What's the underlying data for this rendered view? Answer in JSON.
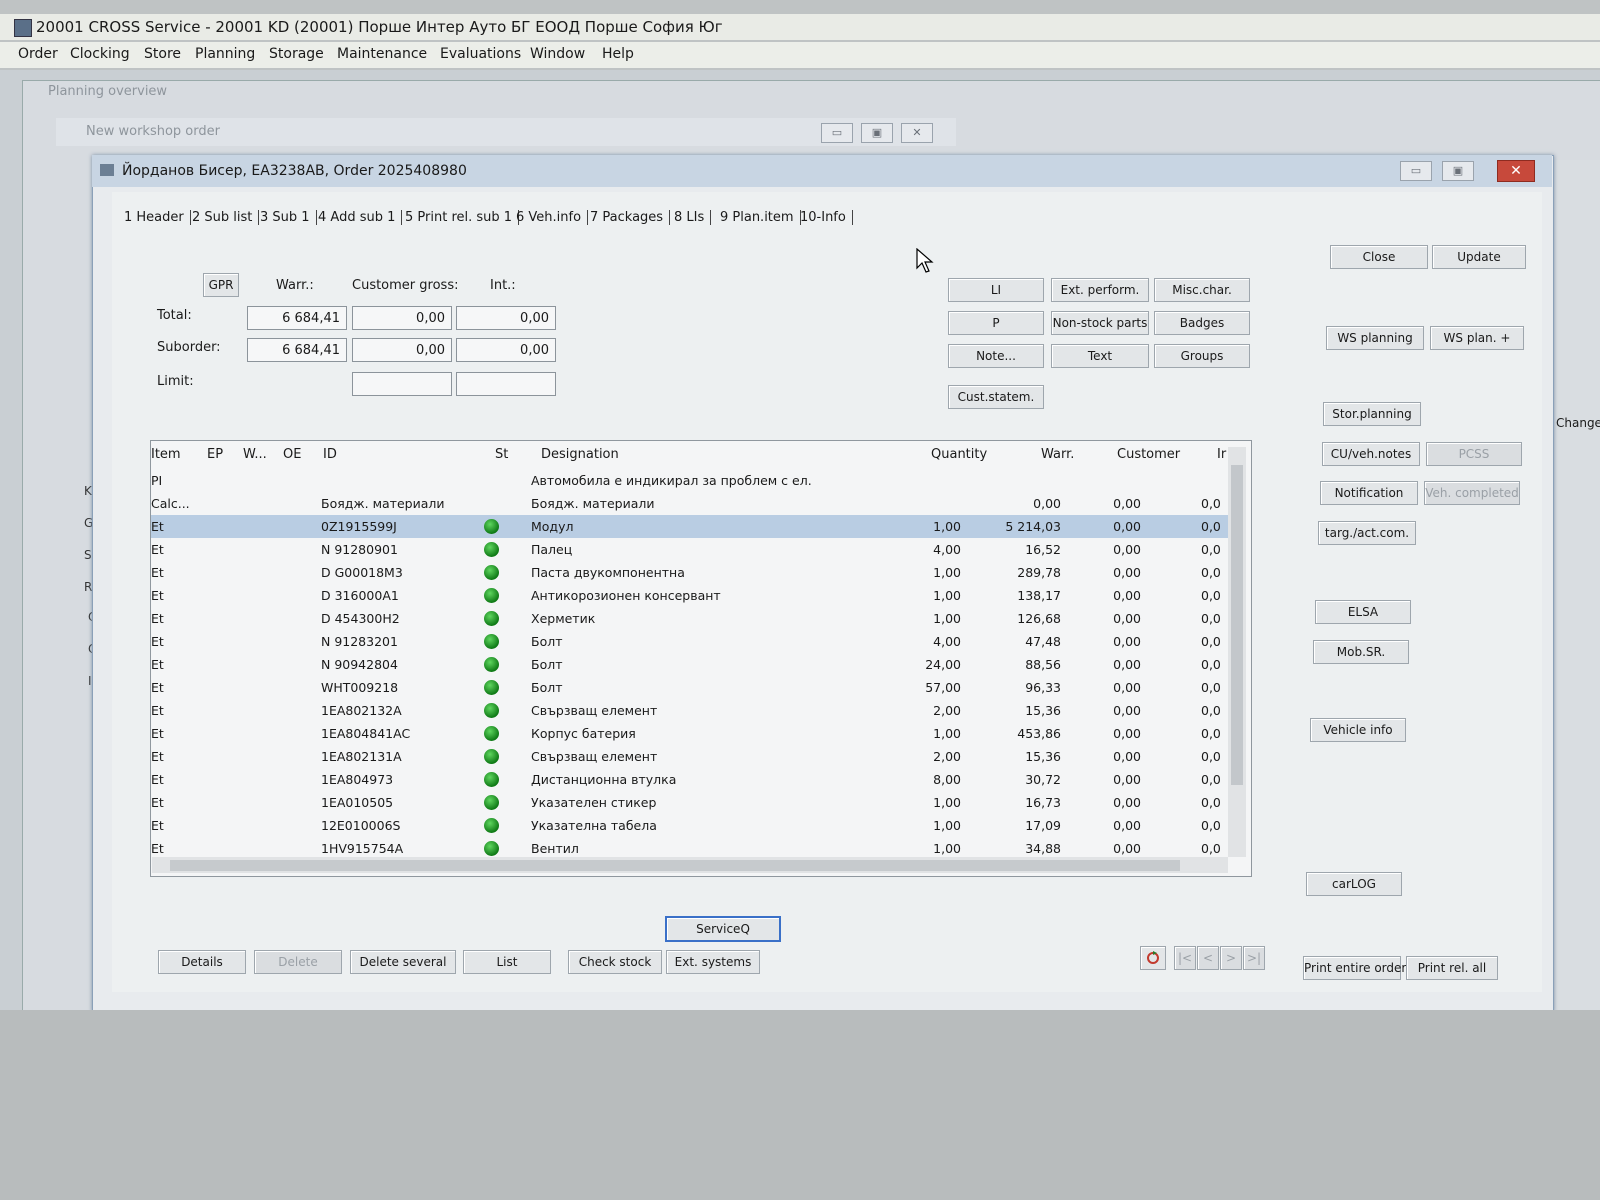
{
  "app": {
    "title": "20001  CROSS Service - 20001 KD (20001) Порше Интер Ауто БГ ЕООД Порше София Юг",
    "menu": [
      "Order",
      "Clocking",
      "Store",
      "Planning",
      "Storage",
      "Maintenance",
      "Evaluations",
      "Window",
      "Help"
    ]
  },
  "windows": {
    "planning_title": "Planning overview",
    "nwo_title": "New workshop order",
    "dialog_title": "Йорданов Бисер, EA3238AB, Order 2025408980",
    "right_edge_label": "Change U/"
  },
  "left_labels": [
    "Kr",
    "G",
    "S",
    "R",
    "O",
    "O",
    "Ir"
  ],
  "tabs": [
    {
      "key": "1",
      "label": "1 Header"
    },
    {
      "key": "2",
      "label": "2 Sub list"
    },
    {
      "key": "3",
      "label": "3 Sub 1"
    },
    {
      "key": "4",
      "label": "4 Add sub 1"
    },
    {
      "key": "5",
      "label": "5 Print rel. sub 1"
    },
    {
      "key": "6",
      "label": "6 Veh.info"
    },
    {
      "key": "7",
      "label": "7 Packages"
    },
    {
      "key": "8",
      "label": "8 LIs"
    },
    {
      "key": "9",
      "label": "9 Plan.item"
    },
    {
      "key": "10",
      "label": "10-Info"
    }
  ],
  "totals": {
    "gpr_label": "GPR",
    "warr_label": "Warr.:",
    "customer_gross_label": "Customer gross:",
    "int_label": "Int.:",
    "total_label": "Total:",
    "suborder_label": "Suborder:",
    "limit_label": "Limit:",
    "total": {
      "warr": "6 684,41",
      "customer": "0,00",
      "int": "0,00"
    },
    "suborder": {
      "warr": "6 684,41",
      "customer": "0,00",
      "int": "0,00"
    },
    "limit": {
      "customer": "",
      "int": ""
    }
  },
  "mid_buttons": {
    "li": "LI",
    "ext_perform": "Ext. perform.",
    "misc_char": "Misc.char.",
    "p": "P",
    "non_stock": "Non-stock parts",
    "badges": "Badges",
    "note": "Note...",
    "text": "Text",
    "groups": "Groups",
    "cust_statem": "Cust.statem."
  },
  "right_buttons": {
    "close": "Close",
    "update": "Update",
    "ws_planning": "WS planning",
    "ws_plan_plus": "WS plan. +",
    "stor_planning": "Stor.planning",
    "cu_veh_notes": "CU/veh.notes",
    "pcss": "PCSS",
    "notification": "Notification",
    "veh_completed": "Veh. completed",
    "targ_act_com": "targ./act.com.",
    "elsa": "ELSA",
    "mob_sr": "Mob.SR.",
    "vehicle_info": "Vehicle info",
    "carlog": "carLOG",
    "print_entire": "Print entire order",
    "print_rel_all": "Print rel. all"
  },
  "grid": {
    "columns": {
      "item": "Item",
      "ep": "EP",
      "w": "W...",
      "oe": "OE",
      "id": "ID",
      "st": "St",
      "designation": "Designation",
      "quantity": "Quantity",
      "warr": "Warr.",
      "customer": "Customer",
      "int": "Ir"
    },
    "rows": [
      {
        "item": "PI",
        "id": "",
        "designation": "Автомобила е индикирал за проблем с ел.",
        "qty": "",
        "warr": "",
        "customer": "",
        "int": "",
        "dot": false,
        "sel": false
      },
      {
        "item": "Calc...",
        "id": "Боядж. материали",
        "designation": "Боядж. материали",
        "qty": "",
        "warr": "0,00",
        "customer": "0,00",
        "int": "0,0",
        "dot": false,
        "sel": false
      },
      {
        "item": "Et",
        "id": "0Z1915599J",
        "designation": "Модул",
        "qty": "1,00",
        "warr": "5 214,03",
        "customer": "0,00",
        "int": "0,0",
        "dot": true,
        "sel": true
      },
      {
        "item": "Et",
        "id": "N  91280901",
        "designation": "Палец",
        "qty": "4,00",
        "warr": "16,52",
        "customer": "0,00",
        "int": "0,0",
        "dot": true,
        "sel": false
      },
      {
        "item": "Et",
        "id": "D  G00018M3",
        "designation": "Паста двукомпонентна",
        "qty": "1,00",
        "warr": "289,78",
        "customer": "0,00",
        "int": "0,0",
        "dot": true,
        "sel": false
      },
      {
        "item": "Et",
        "id": "D  316000A1",
        "designation": "Антикорозионен консервант",
        "qty": "1,00",
        "warr": "138,17",
        "customer": "0,00",
        "int": "0,0",
        "dot": true,
        "sel": false
      },
      {
        "item": "Et",
        "id": "D  454300H2",
        "designation": "Херметик",
        "qty": "1,00",
        "warr": "126,68",
        "customer": "0,00",
        "int": "0,0",
        "dot": true,
        "sel": false
      },
      {
        "item": "Et",
        "id": "N  91283201",
        "designation": "Болт",
        "qty": "4,00",
        "warr": "47,48",
        "customer": "0,00",
        "int": "0,0",
        "dot": true,
        "sel": false
      },
      {
        "item": "Et",
        "id": "N  90942804",
        "designation": "Болт",
        "qty": "24,00",
        "warr": "88,56",
        "customer": "0,00",
        "int": "0,0",
        "dot": true,
        "sel": false
      },
      {
        "item": "Et",
        "id": "WHT009218",
        "designation": "Болт",
        "qty": "57,00",
        "warr": "96,33",
        "customer": "0,00",
        "int": "0,0",
        "dot": true,
        "sel": false
      },
      {
        "item": "Et",
        "id": "1EA802132A",
        "designation": "Свързващ елемент",
        "qty": "2,00",
        "warr": "15,36",
        "customer": "0,00",
        "int": "0,0",
        "dot": true,
        "sel": false
      },
      {
        "item": "Et",
        "id": "1EA804841AC",
        "designation": "Корпус батерия",
        "qty": "1,00",
        "warr": "453,86",
        "customer": "0,00",
        "int": "0,0",
        "dot": true,
        "sel": false
      },
      {
        "item": "Et",
        "id": "1EA802131A",
        "designation": "Свързващ елемент",
        "qty": "2,00",
        "warr": "15,36",
        "customer": "0,00",
        "int": "0,0",
        "dot": true,
        "sel": false
      },
      {
        "item": "Et",
        "id": "1EA804973",
        "designation": "Дистанционна втулка",
        "qty": "8,00",
        "warr": "30,72",
        "customer": "0,00",
        "int": "0,0",
        "dot": true,
        "sel": false
      },
      {
        "item": "Et",
        "id": "1EA010505",
        "designation": "Указателен стикер",
        "qty": "1,00",
        "warr": "16,73",
        "customer": "0,00",
        "int": "0,0",
        "dot": true,
        "sel": false
      },
      {
        "item": "Et",
        "id": "12E010006S",
        "designation": "Указателна табела",
        "qty": "1,00",
        "warr": "17,09",
        "customer": "0,00",
        "int": "0,0",
        "dot": true,
        "sel": false
      },
      {
        "item": "Et",
        "id": "1HV915754A",
        "designation": "Вентил",
        "qty": "1,00",
        "warr": "34,88",
        "customer": "0,00",
        "int": "0,0",
        "dot": true,
        "sel": false
      }
    ]
  },
  "bottom_buttons": {
    "details": "Details",
    "delete": "Delete",
    "delete_several": "Delete several",
    "list": "List",
    "check_stock": "Check stock",
    "ext_systems": "Ext. systems",
    "serviceq": "ServiceQ"
  },
  "nav": {
    "first": "|<",
    "prev": "<",
    "next": ">",
    "last": ">|"
  },
  "colors": {
    "selected_row": "#b9cde3",
    "status_dot": "#1f9a2a",
    "close_btn": "#c7493b"
  }
}
